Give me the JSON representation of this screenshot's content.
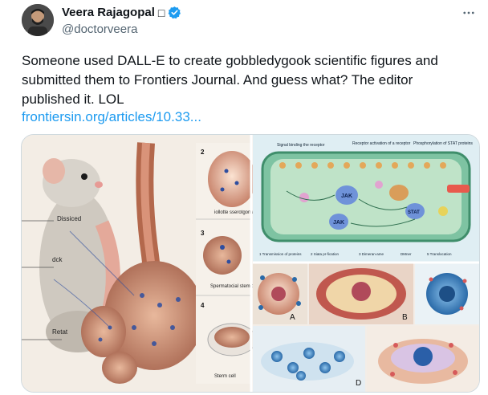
{
  "author": {
    "display_name": "Veera Rajagopal",
    "name_emoji": "□",
    "handle": "@doctorveera",
    "verified": true
  },
  "tweet": {
    "text": "Someone used DALL-E to create gobbledygook scientific figures and submitted them to Frontiers Journal. And guess what? The editor published it. LOL",
    "link": "frontiersin.org/articles/10.33..."
  },
  "icons": {
    "more": "more-options-icon",
    "verified": "verified-badge-icon"
  },
  "figure": {
    "rat_labels": [
      "Dissiced",
      "dck",
      "Retat"
    ],
    "panel_numbers": [
      "2",
      "3",
      "4"
    ],
    "panel_captions": [
      "iollotte sserotgomar",
      "Spermatocial stem cells",
      "Sterm cell"
    ],
    "jak_labels": [
      "JAK",
      "JAK",
      "STAT"
    ],
    "jak_title_top": [
      "Signal binding the receptor",
      "Receptor activation of a receptor",
      "Phosphorylation of STAT proteins"
    ],
    "jak_bottom": [
      "1 Transmission of proteins",
      "2 Siata pr-fication",
      "3 Dimeran-ame",
      "DMner",
      "5 Translocation"
    ],
    "grid_letters": [
      "A",
      "B",
      "D"
    ]
  },
  "colors": {
    "link": "#1d9bf0",
    "text": "#0f1419",
    "secondary": "#536471",
    "verified": "#1d9bf0"
  }
}
